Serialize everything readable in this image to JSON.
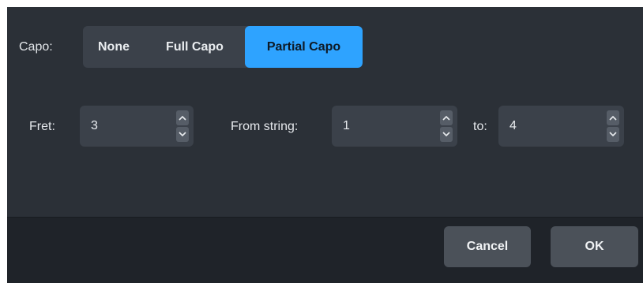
{
  "capo": {
    "label": "Capo:",
    "options": [
      "None",
      "Full Capo",
      "Partial Capo"
    ],
    "selected": "Partial Capo"
  },
  "fret": {
    "label": "Fret:",
    "value": "3"
  },
  "from_string": {
    "label": "From string:",
    "value": "1"
  },
  "to_string": {
    "label": "to:",
    "value": "4"
  },
  "footer": {
    "cancel_label": "Cancel",
    "ok_label": "OK"
  },
  "colors": {
    "dialog_bg": "#2b3037",
    "footer_bg": "#1f2329",
    "control_bg": "#3b414a",
    "accent": "#2ea3ff",
    "button_bg": "#4b5159"
  },
  "icons": {
    "increment": "chevron-up-icon",
    "decrement": "chevron-down-icon"
  }
}
